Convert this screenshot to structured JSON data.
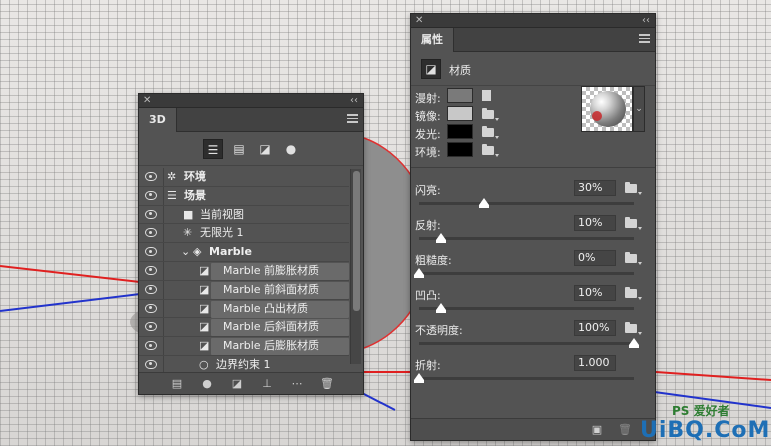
{
  "panel_3d": {
    "tab": "3D",
    "filters": [
      "scene-filter-icon",
      "mesh-filter-icon",
      "material-filter-icon",
      "light-filter-icon"
    ],
    "layers": [
      {
        "label": "环境",
        "icon": "environment-icon",
        "indent": 0,
        "bold": true,
        "material": false
      },
      {
        "label": "场景",
        "icon": "scene-icon",
        "indent": 0,
        "bold": true,
        "material": false
      },
      {
        "label": "当前视图",
        "icon": "camera-icon",
        "indent": 1,
        "bold": false,
        "material": false
      },
      {
        "label": "无限光 1",
        "icon": "infinite-light-icon",
        "indent": 1,
        "bold": false,
        "material": false
      },
      {
        "label": "Marble",
        "icon": "mesh-icon",
        "indent": 1,
        "bold": true,
        "material": false
      },
      {
        "label": "Marble 前膨胀材质",
        "icon": "material-icon",
        "indent": 2,
        "bold": false,
        "material": true
      },
      {
        "label": "Marble 前斜面材质",
        "icon": "material-icon",
        "indent": 2,
        "bold": false,
        "material": true
      },
      {
        "label": "Marble 凸出材质",
        "icon": "material-icon",
        "indent": 2,
        "bold": false,
        "material": true
      },
      {
        "label": "Marble 后斜面材质",
        "icon": "material-icon",
        "indent": 2,
        "bold": false,
        "material": true
      },
      {
        "label": "Marble 后膨胀材质",
        "icon": "material-icon",
        "indent": 2,
        "bold": false,
        "material": true
      },
      {
        "label": "边界约束 1",
        "icon": "constraint-icon",
        "indent": 2,
        "bold": false,
        "material": false
      }
    ]
  },
  "panel_props": {
    "tab": "属性",
    "section_title": "材质",
    "swatches": [
      {
        "label": "漫射:",
        "color": "#7a7a7a"
      },
      {
        "label": "镜像:",
        "color": "#c8c8c8"
      },
      {
        "label": "发光:",
        "color": "#000000"
      },
      {
        "label": "环境:",
        "color": "#000000"
      }
    ],
    "sliders": [
      {
        "label": "闪亮:",
        "value": "30%",
        "level": 0.3
      },
      {
        "label": "反射:",
        "value": "10%",
        "level": 0.1
      },
      {
        "label": "粗糙度:",
        "value": "0%",
        "level": 0.0
      },
      {
        "label": "凹凸:",
        "value": "10%",
        "level": 0.1
      },
      {
        "label": "不透明度:",
        "value": "100%",
        "level": 1.0
      },
      {
        "label": "折射:",
        "value": "1.000",
        "level": 0.0
      }
    ]
  },
  "watermark": {
    "top": "PS 爱好者",
    "bottom": "UiBQ.CoM"
  },
  "colors": {
    "axis_red": "#e02020",
    "axis_blue": "#2233cc"
  }
}
